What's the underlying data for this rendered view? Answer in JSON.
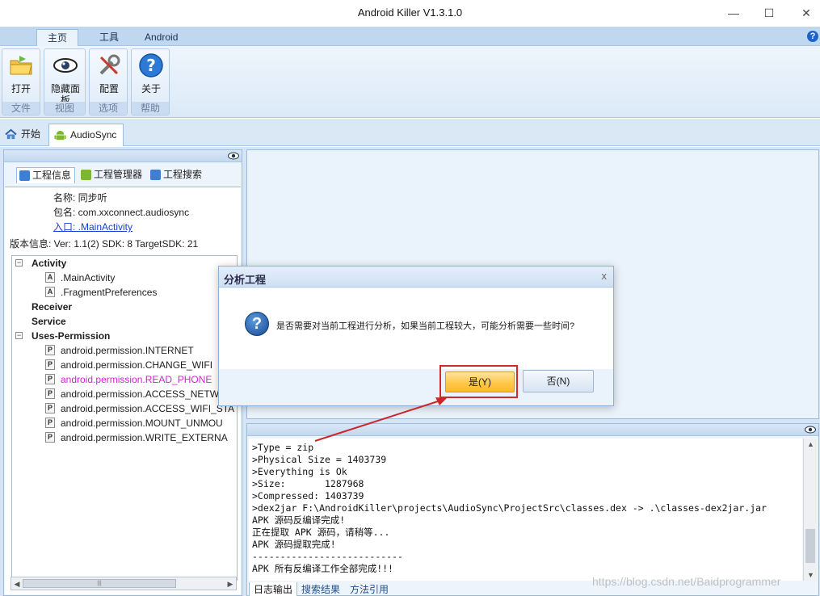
{
  "window": {
    "title": "Android Killer V1.3.1.0",
    "minimize": "—",
    "maximize": "☐",
    "close": "✕"
  },
  "ribbon_tabs": [
    "主页",
    "工具",
    "Android"
  ],
  "ribbon_groups": [
    {
      "label": "文件",
      "button": "打开"
    },
    {
      "label": "视图",
      "button": "隐藏面板"
    },
    {
      "label": "选项",
      "button": "配置"
    },
    {
      "label": "帮助",
      "button": "关于"
    }
  ],
  "doc_tabs": [
    "开始",
    "AudioSync"
  ],
  "left_subtabs": [
    "工程信息",
    "工程管理器",
    "工程搜索"
  ],
  "project_info": {
    "name_line": "名称: 同步听",
    "package_line": "包名: com.xxconnect.audiosync",
    "entry_line": "入口: .MainActivity",
    "version_line": "版本信息: Ver: 1.1(2) SDK: 8 TargetSDK: 21"
  },
  "tree": {
    "activity": {
      "label": "Activity",
      "items": [
        ".MainActivity",
        ".FragmentPreferences"
      ]
    },
    "receiver": "Receiver",
    "service": "Service",
    "uses_permission": {
      "label": "Uses-Permission",
      "items": [
        "android.permission.INTERNET",
        "android.permission.CHANGE_WIFI",
        "android.permission.READ_PHONE",
        "android.permission.ACCESS_NETW",
        "android.permission.ACCESS_WIFI_STA",
        "android.permission.MOUNT_UNMOU",
        "android.permission.WRITE_EXTERNA"
      ]
    }
  },
  "log_lines": [
    ">Type = zip",
    ">Physical Size = 1403739",
    ">Everything is Ok",
    ">Size:       1287968",
    ">Compressed: 1403739",
    ">dex2jar F:\\AndroidKiller\\projects\\AudioSync\\ProjectSrc\\classes.dex -> .\\classes-dex2jar.jar",
    "APK 源码反编译完成!",
    "正在提取 APK 源码，请稍等...",
    "APK 源码提取完成!",
    "---------------------------",
    "APK 所有反编译工作全部完成!!!"
  ],
  "log_tabs": [
    "日志输出",
    "搜索结果",
    "方法引用"
  ],
  "dialog": {
    "title": "分析工程",
    "close": "x",
    "message": "是否需要对当前工程进行分析，如果当前工程较大，可能分析需要一些时间?",
    "yes_label": "是(Y)",
    "no_label": "否(N)"
  },
  "watermark": "https://blog.csdn.net/Baidprogrammer",
  "colors": {
    "accent": "#d02b2b",
    "permission_highlight": "#d41fd4",
    "yes_button": "#ffc84a"
  }
}
